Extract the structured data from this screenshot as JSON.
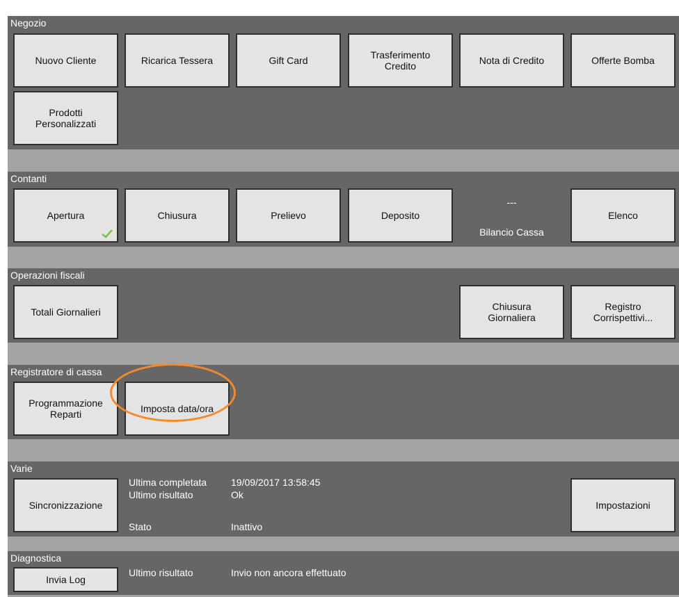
{
  "colors": {
    "panel": "#666666",
    "divider": "#a4a4a4",
    "button": "#e4e4e4",
    "highlight": "#f58a2a",
    "check": "#7cc242"
  },
  "negozio": {
    "title": "Negozio",
    "buttons": [
      "Nuovo Cliente",
      "Ricarica Tessera",
      "Gift Card",
      "Trasferimento\nCredito",
      "Nota di Credito",
      "Offerte Bomba",
      "Prodotti\nPersonalizzati"
    ]
  },
  "contanti": {
    "title": "Contanti",
    "buttons": [
      "Apertura",
      "Chiusura",
      "Prelievo",
      "Deposito",
      "Elenco"
    ],
    "apertura_status_icon": "check-icon",
    "balance_value": "---",
    "balance_label": "Bilancio Cassa"
  },
  "fiscali": {
    "title": "Operazioni fiscali",
    "buttons": [
      "Totali Giornalieri",
      "Chiusura\nGiornaliera",
      "Registro\nCorrispettivi..."
    ]
  },
  "registratore": {
    "title": "Registratore di cassa",
    "buttons": [
      "Programmazione\nReparti",
      "Imposta data/ora"
    ]
  },
  "varie": {
    "title": "Varie",
    "sync_button": "Sincronizzazione",
    "settings_button": "Impostazioni",
    "last_completed_label": "Ultima completata",
    "last_completed_value": "19/09/2017 13:58:45",
    "last_result_label": "Ultimo risultato",
    "last_result_value": "Ok",
    "state_label": "Stato",
    "state_value": "Inattivo"
  },
  "diagnostica": {
    "title": "Diagnostica",
    "send_log_button": "Invia Log",
    "last_result_label": "Ultimo risultato",
    "last_result_value": "Invio non ancora effettuato"
  }
}
